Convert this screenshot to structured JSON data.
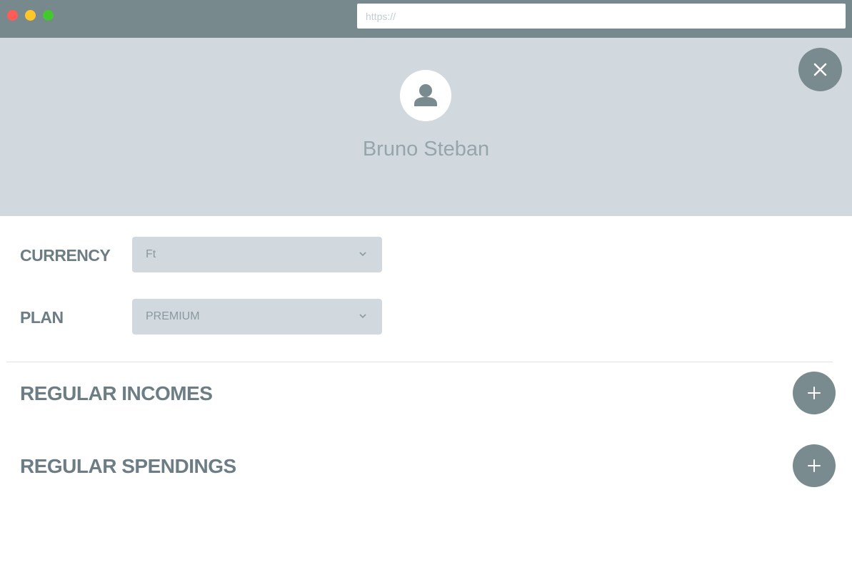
{
  "browser": {
    "url_placeholder": "https://",
    "url_value": ""
  },
  "profile": {
    "name": "Bruno Steban",
    "avatar_icon": "user-icon",
    "close_icon": "close-icon"
  },
  "settings": {
    "currency": {
      "label": "CURRENCY",
      "value": "Ft"
    },
    "plan": {
      "label": "PLAN",
      "value": "PREMIUM"
    },
    "dropdown_icon": "chevron-down-icon"
  },
  "sections": {
    "incomes": {
      "title": "REGULAR INCOMES",
      "icon": "plus-icon"
    },
    "spendings": {
      "title": "REGULAR SPENDINGS",
      "icon": "plus-icon"
    }
  },
  "colors": {
    "titlebar": "#78898d",
    "header_bg": "#d1d9de",
    "accent_button": "#7a8b90",
    "label_text": "#6c7d84"
  }
}
